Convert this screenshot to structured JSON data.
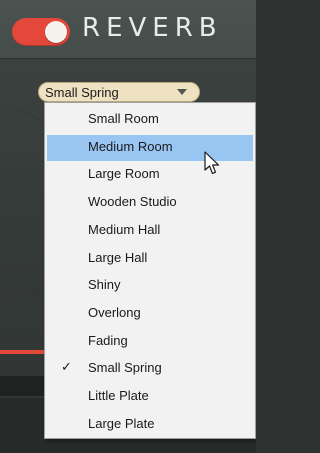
{
  "header": {
    "title": "REVERB",
    "power_on": true
  },
  "preset_select": {
    "value": "Small Spring"
  },
  "dropdown": {
    "options": [
      {
        "label": "Small Room",
        "selected": false,
        "hovered": false
      },
      {
        "label": "Medium Room",
        "selected": false,
        "hovered": true
      },
      {
        "label": "Large Room",
        "selected": false,
        "hovered": false
      },
      {
        "label": "Wooden Studio",
        "selected": false,
        "hovered": false
      },
      {
        "label": "Medium Hall",
        "selected": false,
        "hovered": false
      },
      {
        "label": "Large Hall",
        "selected": false,
        "hovered": false
      },
      {
        "label": "Shiny",
        "selected": false,
        "hovered": false
      },
      {
        "label": "Overlong",
        "selected": false,
        "hovered": false
      },
      {
        "label": "Fading",
        "selected": false,
        "hovered": false
      },
      {
        "label": "Small Spring",
        "selected": true,
        "hovered": false
      },
      {
        "label": "Little Plate",
        "selected": false,
        "hovered": false
      },
      {
        "label": "Large Plate",
        "selected": false,
        "hovered": false
      }
    ],
    "check_glyph": "✓",
    "hover_color": "#99c5f2"
  },
  "colors": {
    "accent": "#e4483a",
    "panel": "#3d4441",
    "select_bg": "#efe2c2"
  },
  "icons": {
    "power": "power-toggle-icon",
    "arrow": "chevron-down-icon",
    "cursor": "mouse-pointer-icon"
  }
}
